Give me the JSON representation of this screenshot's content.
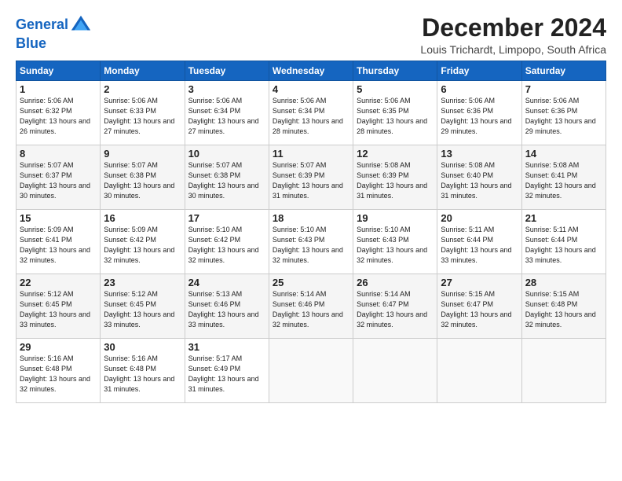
{
  "logo": {
    "line1": "General",
    "line2": "Blue"
  },
  "title": "December 2024",
  "location": "Louis Trichardt, Limpopo, South Africa",
  "weekdays": [
    "Sunday",
    "Monday",
    "Tuesday",
    "Wednesday",
    "Thursday",
    "Friday",
    "Saturday"
  ],
  "weeks": [
    [
      {
        "day": "1",
        "sunrise": "Sunrise: 5:06 AM",
        "sunset": "Sunset: 6:32 PM",
        "daylight": "Daylight: 13 hours and 26 minutes."
      },
      {
        "day": "2",
        "sunrise": "Sunrise: 5:06 AM",
        "sunset": "Sunset: 6:33 PM",
        "daylight": "Daylight: 13 hours and 27 minutes."
      },
      {
        "day": "3",
        "sunrise": "Sunrise: 5:06 AM",
        "sunset": "Sunset: 6:34 PM",
        "daylight": "Daylight: 13 hours and 27 minutes."
      },
      {
        "day": "4",
        "sunrise": "Sunrise: 5:06 AM",
        "sunset": "Sunset: 6:34 PM",
        "daylight": "Daylight: 13 hours and 28 minutes."
      },
      {
        "day": "5",
        "sunrise": "Sunrise: 5:06 AM",
        "sunset": "Sunset: 6:35 PM",
        "daylight": "Daylight: 13 hours and 28 minutes."
      },
      {
        "day": "6",
        "sunrise": "Sunrise: 5:06 AM",
        "sunset": "Sunset: 6:36 PM",
        "daylight": "Daylight: 13 hours and 29 minutes."
      },
      {
        "day": "7",
        "sunrise": "Sunrise: 5:06 AM",
        "sunset": "Sunset: 6:36 PM",
        "daylight": "Daylight: 13 hours and 29 minutes."
      }
    ],
    [
      {
        "day": "8",
        "sunrise": "Sunrise: 5:07 AM",
        "sunset": "Sunset: 6:37 PM",
        "daylight": "Daylight: 13 hours and 30 minutes."
      },
      {
        "day": "9",
        "sunrise": "Sunrise: 5:07 AM",
        "sunset": "Sunset: 6:38 PM",
        "daylight": "Daylight: 13 hours and 30 minutes."
      },
      {
        "day": "10",
        "sunrise": "Sunrise: 5:07 AM",
        "sunset": "Sunset: 6:38 PM",
        "daylight": "Daylight: 13 hours and 30 minutes."
      },
      {
        "day": "11",
        "sunrise": "Sunrise: 5:07 AM",
        "sunset": "Sunset: 6:39 PM",
        "daylight": "Daylight: 13 hours and 31 minutes."
      },
      {
        "day": "12",
        "sunrise": "Sunrise: 5:08 AM",
        "sunset": "Sunset: 6:39 PM",
        "daylight": "Daylight: 13 hours and 31 minutes."
      },
      {
        "day": "13",
        "sunrise": "Sunrise: 5:08 AM",
        "sunset": "Sunset: 6:40 PM",
        "daylight": "Daylight: 13 hours and 31 minutes."
      },
      {
        "day": "14",
        "sunrise": "Sunrise: 5:08 AM",
        "sunset": "Sunset: 6:41 PM",
        "daylight": "Daylight: 13 hours and 32 minutes."
      }
    ],
    [
      {
        "day": "15",
        "sunrise": "Sunrise: 5:09 AM",
        "sunset": "Sunset: 6:41 PM",
        "daylight": "Daylight: 13 hours and 32 minutes."
      },
      {
        "day": "16",
        "sunrise": "Sunrise: 5:09 AM",
        "sunset": "Sunset: 6:42 PM",
        "daylight": "Daylight: 13 hours and 32 minutes."
      },
      {
        "day": "17",
        "sunrise": "Sunrise: 5:10 AM",
        "sunset": "Sunset: 6:42 PM",
        "daylight": "Daylight: 13 hours and 32 minutes."
      },
      {
        "day": "18",
        "sunrise": "Sunrise: 5:10 AM",
        "sunset": "Sunset: 6:43 PM",
        "daylight": "Daylight: 13 hours and 32 minutes."
      },
      {
        "day": "19",
        "sunrise": "Sunrise: 5:10 AM",
        "sunset": "Sunset: 6:43 PM",
        "daylight": "Daylight: 13 hours and 32 minutes."
      },
      {
        "day": "20",
        "sunrise": "Sunrise: 5:11 AM",
        "sunset": "Sunset: 6:44 PM",
        "daylight": "Daylight: 13 hours and 33 minutes."
      },
      {
        "day": "21",
        "sunrise": "Sunrise: 5:11 AM",
        "sunset": "Sunset: 6:44 PM",
        "daylight": "Daylight: 13 hours and 33 minutes."
      }
    ],
    [
      {
        "day": "22",
        "sunrise": "Sunrise: 5:12 AM",
        "sunset": "Sunset: 6:45 PM",
        "daylight": "Daylight: 13 hours and 33 minutes."
      },
      {
        "day": "23",
        "sunrise": "Sunrise: 5:12 AM",
        "sunset": "Sunset: 6:45 PM",
        "daylight": "Daylight: 13 hours and 33 minutes."
      },
      {
        "day": "24",
        "sunrise": "Sunrise: 5:13 AM",
        "sunset": "Sunset: 6:46 PM",
        "daylight": "Daylight: 13 hours and 33 minutes."
      },
      {
        "day": "25",
        "sunrise": "Sunrise: 5:14 AM",
        "sunset": "Sunset: 6:46 PM",
        "daylight": "Daylight: 13 hours and 32 minutes."
      },
      {
        "day": "26",
        "sunrise": "Sunrise: 5:14 AM",
        "sunset": "Sunset: 6:47 PM",
        "daylight": "Daylight: 13 hours and 32 minutes."
      },
      {
        "day": "27",
        "sunrise": "Sunrise: 5:15 AM",
        "sunset": "Sunset: 6:47 PM",
        "daylight": "Daylight: 13 hours and 32 minutes."
      },
      {
        "day": "28",
        "sunrise": "Sunrise: 5:15 AM",
        "sunset": "Sunset: 6:48 PM",
        "daylight": "Daylight: 13 hours and 32 minutes."
      }
    ],
    [
      {
        "day": "29",
        "sunrise": "Sunrise: 5:16 AM",
        "sunset": "Sunset: 6:48 PM",
        "daylight": "Daylight: 13 hours and 32 minutes."
      },
      {
        "day": "30",
        "sunrise": "Sunrise: 5:16 AM",
        "sunset": "Sunset: 6:48 PM",
        "daylight": "Daylight: 13 hours and 31 minutes."
      },
      {
        "day": "31",
        "sunrise": "Sunrise: 5:17 AM",
        "sunset": "Sunset: 6:49 PM",
        "daylight": "Daylight: 13 hours and 31 minutes."
      },
      null,
      null,
      null,
      null
    ]
  ]
}
